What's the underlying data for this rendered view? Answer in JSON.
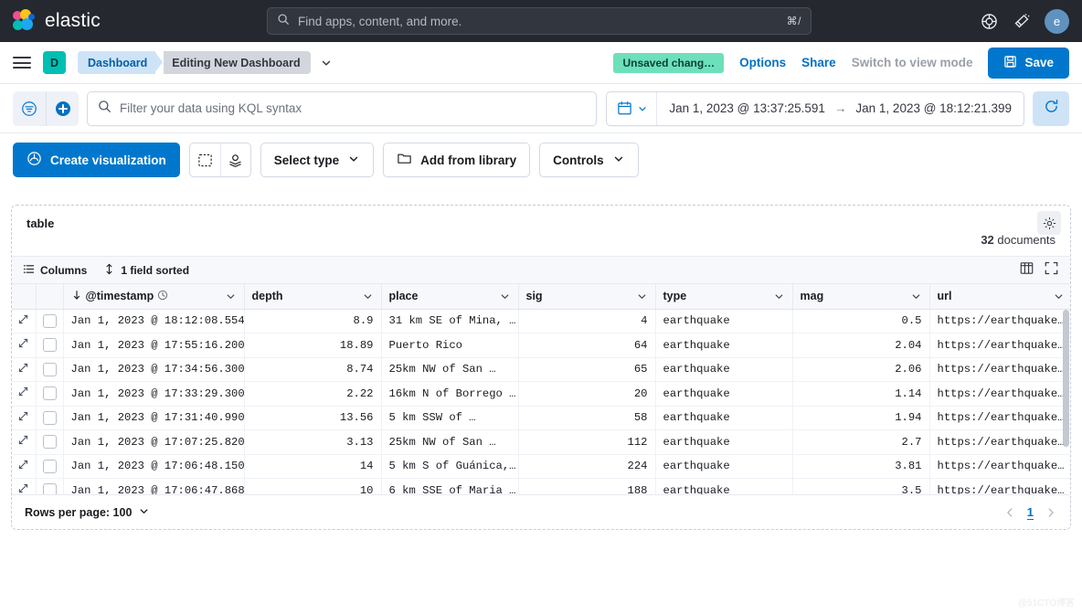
{
  "global_nav": {
    "brand": "elastic",
    "search": {
      "placeholder": "Find apps, content, and more.",
      "shortcut": "⌘/"
    },
    "help_icon": "help-circle-icon",
    "announcements_icon": "megaphone-icon",
    "avatar_initial": "e"
  },
  "breadcrumb_bar": {
    "menu_icon": "hamburger-menu-icon",
    "app_badge": "D",
    "crumbs": [
      {
        "label": "Dashboard"
      },
      {
        "label": "Editing New Dashboard"
      }
    ],
    "crumb_chevron_icon": "chevron-down-icon",
    "unsaved_badge": "Unsaved chang…",
    "options_label": "Options",
    "share_label": "Share",
    "view_mode_label": "Switch to view mode",
    "save_label": "Save",
    "save_icon": "floppy-disk-icon"
  },
  "query_bar": {
    "filter_icon": "filter-icon",
    "add_filter_icon": "plus-circle-icon",
    "kql_placeholder": "Filter your data using KQL syntax",
    "search_icon": "search-icon",
    "calendar_icon": "calendar-icon",
    "date_start": "Jan 1, 2023 @ 13:37:25.591",
    "date_arrow": "→",
    "date_end": "Jan 1, 2023 @ 18:12:21.399",
    "refresh_icon": "refresh-icon"
  },
  "edit_toolbar": {
    "create_visualization": "Create visualization",
    "create_visualization_icon": "lens-icon",
    "text_icon": "text-box-icon",
    "image_icon": "map-marker-icon",
    "select_type": "Select type",
    "add_from_library": "Add from library",
    "add_from_library_icon": "folder-icon",
    "controls": "Controls",
    "chevron_icon": "chevron-down-icon"
  },
  "panel": {
    "title": "table",
    "gear_icon": "gear-icon",
    "doc_count_number": "32",
    "doc_count_label": "documents",
    "grid_toolbar": {
      "columns_label": "Columns",
      "columns_icon": "list-icon",
      "sort_label": "1 field sorted",
      "sort_icon": "sort-updown-icon",
      "density_icon": "density-icon",
      "fullscreen_icon": "fullscreen-icon"
    },
    "footer": {
      "rows_per_page_label": "Rows per page: 100",
      "rows_chevron_icon": "chevron-down-icon",
      "prev_icon": "chevron-left-icon",
      "next_icon": "chevron-right-icon",
      "current_page": "1"
    }
  },
  "grid": {
    "columns": [
      {
        "key": "timestamp",
        "label": "@timestamp",
        "sorted": "desc",
        "sort_icon": "arrow-down-icon",
        "time_icon": "clock-icon",
        "align": "left"
      },
      {
        "key": "depth",
        "label": "depth",
        "align": "right"
      },
      {
        "key": "place",
        "label": "place",
        "align": "left"
      },
      {
        "key": "sig",
        "label": "sig",
        "align": "right"
      },
      {
        "key": "type",
        "label": "type",
        "align": "left"
      },
      {
        "key": "mag",
        "label": "mag",
        "align": "right"
      },
      {
        "key": "url",
        "label": "url",
        "align": "left"
      }
    ],
    "rows": [
      {
        "timestamp": "Jan 1, 2023 @ 18:12:08.554",
        "depth": "8.9",
        "place": "31 km SE of Mina, …",
        "sig": "4",
        "type": "earthquake",
        "mag": "0.5",
        "url": "https://earthquake…"
      },
      {
        "timestamp": "Jan 1, 2023 @ 17:55:16.200",
        "depth": "18.89",
        "place": "Puerto Rico",
        "sig": "64",
        "type": "earthquake",
        "mag": "2.04",
        "url": "https://earthquake…"
      },
      {
        "timestamp": "Jan 1, 2023 @ 17:34:56.300",
        "depth": "8.74",
        "place": "25km NW of San …",
        "sig": "65",
        "type": "earthquake",
        "mag": "2.06",
        "url": "https://earthquake…"
      },
      {
        "timestamp": "Jan 1, 2023 @ 17:33:29.300",
        "depth": "2.22",
        "place": "16km N of Borrego …",
        "sig": "20",
        "type": "earthquake",
        "mag": "1.14",
        "url": "https://earthquake…"
      },
      {
        "timestamp": "Jan 1, 2023 @ 17:31:40.990",
        "depth": "13.56",
        "place": "5 km SSW of …",
        "sig": "58",
        "type": "earthquake",
        "mag": "1.94",
        "url": "https://earthquake…"
      },
      {
        "timestamp": "Jan 1, 2023 @ 17:07:25.820",
        "depth": "3.13",
        "place": "25km NW of San …",
        "sig": "112",
        "type": "earthquake",
        "mag": "2.7",
        "url": "https://earthquake…"
      },
      {
        "timestamp": "Jan 1, 2023 @ 17:06:48.150",
        "depth": "14",
        "place": "5 km S of Guánica,…",
        "sig": "224",
        "type": "earthquake",
        "mag": "3.81",
        "url": "https://earthquake…"
      },
      {
        "timestamp": "Jan 1, 2023 @ 17:06:47.868",
        "depth": "10",
        "place": "6 km SSE of Maria …",
        "sig": "188",
        "type": "earthquake",
        "mag": "3.5",
        "url": "https://earthquake…"
      }
    ]
  },
  "watermark": "@51CTO博客",
  "colors": {
    "accent": "#0077cc",
    "nav_bg": "#25282f",
    "badge_green": "#6edfbb",
    "app_badge_teal": "#00bfb3"
  }
}
